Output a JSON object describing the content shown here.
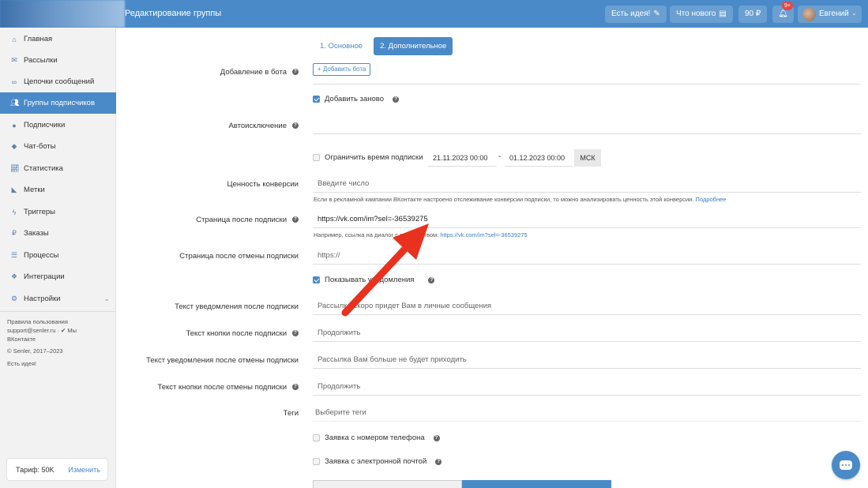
{
  "header": {
    "title": "Редактирование группы",
    "idea_label": "Есть идея!",
    "whats_new_label": "Что нового",
    "balance_label": "90 ₽",
    "notifications_badge": "9+",
    "user_name": "Евгений"
  },
  "sidebar": {
    "items": [
      {
        "label": "Главная",
        "icon": "home-icon"
      },
      {
        "label": "Рассылки",
        "icon": "envelope-icon"
      },
      {
        "label": "Цепочки сообщений",
        "icon": "link-icon"
      },
      {
        "label": "Группы подписчиков",
        "icon": "users-icon",
        "active": true
      },
      {
        "label": "Подписчики",
        "icon": "user-icon"
      },
      {
        "label": "Чат-боты",
        "icon": "android-icon"
      },
      {
        "label": "Статистика",
        "icon": "chart-icon"
      },
      {
        "label": "Метки",
        "icon": "tag-icon"
      },
      {
        "label": "Триггеры",
        "icon": "bolt-icon"
      },
      {
        "label": "Заказы",
        "icon": "ruble-icon"
      },
      {
        "label": "Процессы",
        "icon": "list-icon"
      },
      {
        "label": "Интеграции",
        "icon": "cubes-icon"
      },
      {
        "label": "Настройки",
        "icon": "cogs-icon"
      }
    ],
    "footer": {
      "terms": "Правила пользования",
      "support": "support@senler.ru · ✔ Мы",
      "vk": "ВКонтакте",
      "copyright": "© Senler, 2017–2023",
      "idea": "Есть идея!"
    },
    "tariff_label": "Тариф: 50K",
    "tariff_change": "Изменить"
  },
  "tabs": [
    {
      "label": "1. Основное",
      "active": false
    },
    {
      "label": "2. Дополнительное",
      "active": true
    }
  ],
  "form": {
    "add_to_bot_label": "Добавление в бота",
    "add_bot_button": "+ Добавить бота",
    "re_add_checkbox": "Добавить заново",
    "auto_exclude_label": "Автоисключение",
    "limit_time_checkbox": "Ограничить время подписки",
    "date_from": "21.11.2023 00:00",
    "date_sep": "-",
    "date_to": "01.12.2023 00:00",
    "timezone": "МСК",
    "conversion_label": "Ценность конверсии",
    "conversion_placeholder": "Введите число",
    "conversion_hint": "Если в рекламной кампании ВКонтакте настроено отслеживание конверсии подписки, то можно анализировать ценность этой конверсии.",
    "conversion_hint_link": "Подробнее",
    "after_sub_page_label": "Страница после подписки",
    "after_sub_page_value": "https://vk.com/im?sel=-36539275",
    "after_sub_page_hint": "Например, ссылка на диалог с сообществом:",
    "after_sub_page_hint_link": "https://vk.com/im?sel=-36539275",
    "after_unsub_page_label": "Страница после отмены подписки",
    "after_unsub_page_placeholder": "https://",
    "show_notifications_checkbox": "Показывать уведомления",
    "sub_notif_text_label": "Текст уведомления после подписки",
    "sub_notif_text_placeholder": "Рассылка скоро придет Вам в личные сообщения",
    "sub_button_text_label": "Текст кнопки после подписки",
    "sub_button_text_placeholder": "Продолжить",
    "unsub_notif_text_label": "Текст уведомления после отмены подписки",
    "unsub_notif_text_placeholder": "Рассылка Вам больше не будет приходить",
    "unsub_button_text_label": "Текст кнопки после отмены подписки",
    "unsub_button_text_placeholder": "Продолжить",
    "tags_label": "Теги",
    "tags_placeholder": "Выберите теги",
    "phone_request_checkbox": "Заявка с номером телефона",
    "email_request_checkbox": "Заявка с электронной почтой"
  },
  "colors": {
    "accent": "#4a8ac8",
    "annotation_arrow": "#e8321f"
  }
}
